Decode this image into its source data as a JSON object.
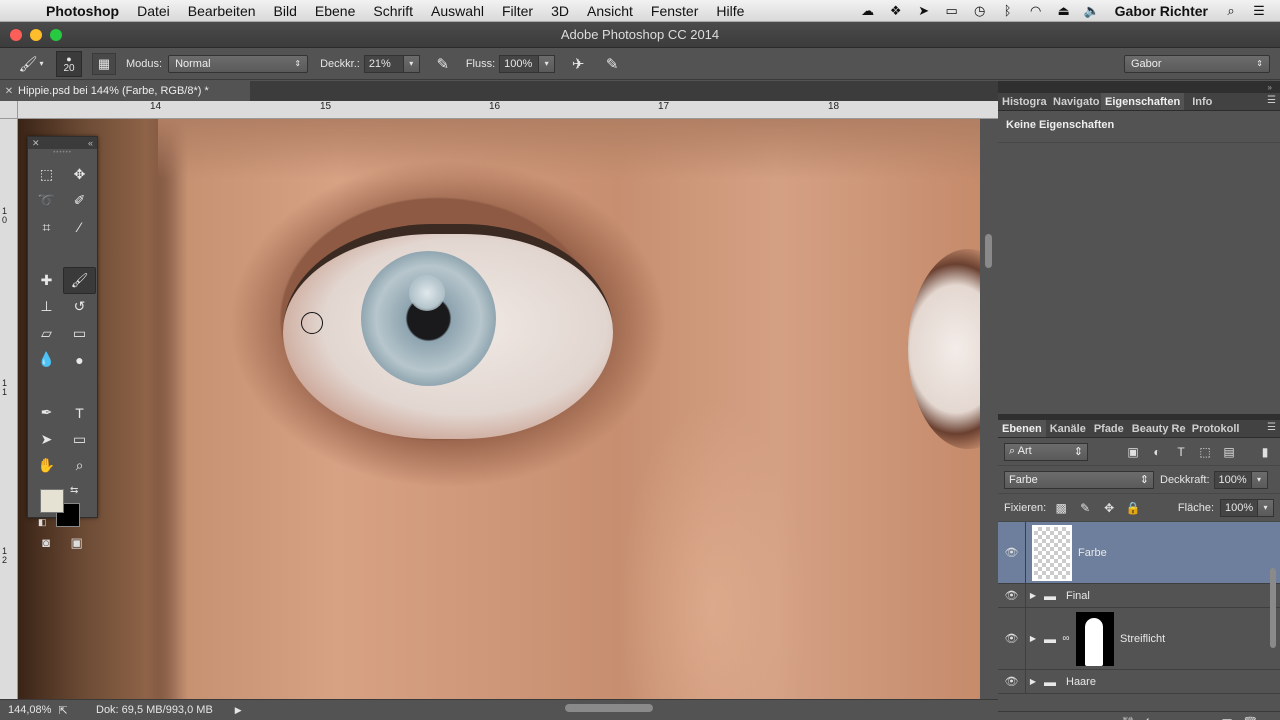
{
  "menubar": {
    "app_name": "Photoshop",
    "items": [
      "Datei",
      "Bearbeiten",
      "Bild",
      "Ebene",
      "Schrift",
      "Auswahl",
      "Filter",
      "3D",
      "Ansicht",
      "Fenster",
      "Hilfe"
    ],
    "user": "Gabor Richter"
  },
  "window": {
    "title": "Adobe Photoshop CC 2014"
  },
  "options": {
    "brush_size": "20",
    "mode_label": "Modus:",
    "mode_value": "Normal",
    "opacity_label": "Deckkr.:",
    "opacity_value": "21%",
    "flow_label": "Fluss:",
    "flow_value": "100%",
    "workspace": "Gabor"
  },
  "document": {
    "tab_title": "Hippie.psd bei 144% (Farbe, RGB/8*) *",
    "ruler_h": [
      "14",
      "15",
      "16",
      "17",
      "18"
    ],
    "ruler_v": [
      "1\n0",
      "1\n1",
      "1\n2"
    ]
  },
  "status": {
    "zoom": "144,08%",
    "doc_info": "Dok: 69,5 MB/993,0 MB"
  },
  "panels": {
    "top_tabs": [
      "Histogra",
      "Navigato",
      "Eigenschaften",
      "Info"
    ],
    "properties_text": "Keine Eigenschaften",
    "layer_tabs": [
      "Ebenen",
      "Kanäle",
      "Pfade",
      "Beauty Re",
      "Protokoll"
    ],
    "filter_kind": "Art",
    "blend_mode": "Farbe",
    "opacity_label": "Deckkraft:",
    "opacity_value": "100%",
    "lock_label": "Fixieren:",
    "fill_label": "Fläche:",
    "fill_value": "100%",
    "layers": [
      {
        "name": "Farbe"
      },
      {
        "name": "Final"
      },
      {
        "name": "Streiflicht"
      },
      {
        "name": "Haare"
      }
    ]
  },
  "colors": {
    "foreground": "#e5e1d3",
    "background": "#000000",
    "selected_layer": "#6d7f9c"
  }
}
